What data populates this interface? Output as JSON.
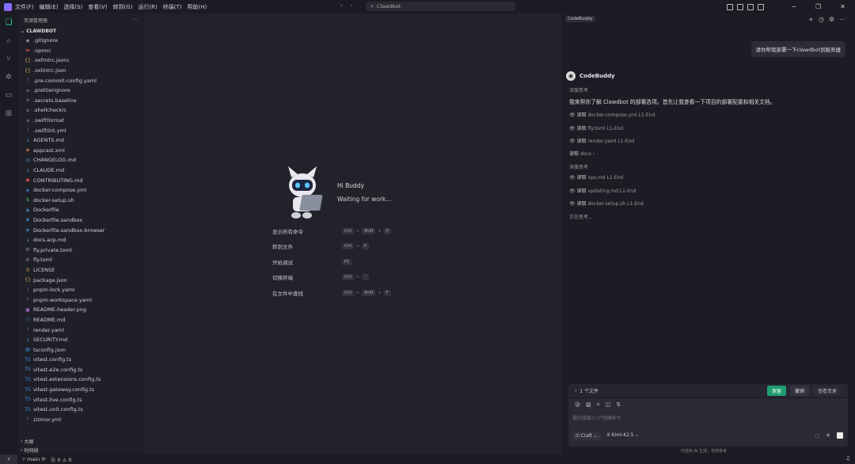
{
  "menu": [
    "文件(F)",
    "编辑(E)",
    "选择(S)",
    "查看(V)",
    "转到(G)",
    "运行(R)",
    "终端(T)",
    "帮助(H)"
  ],
  "search": {
    "text": "Clawdbot"
  },
  "sidebar": {
    "title": "资源管理器",
    "more": "···",
    "project": "CLAWDBOT",
    "files": [
      {
        "name": ".gitignore",
        "icon": "◆",
        "color": "#8a8a95"
      },
      {
        "name": ".npmrc",
        "icon": "▬",
        "color": "#c2413b"
      },
      {
        "name": ".oxfmtrc.jsonc",
        "icon": "{}",
        "color": "#d5b445"
      },
      {
        "name": ".oxlintrc.json",
        "icon": "{}",
        "color": "#d5b445"
      },
      {
        "name": ".pre-commit-config.yaml",
        "icon": "!",
        "color": "#a96fd6"
      },
      {
        "name": ".prettierignore",
        "icon": "≡",
        "color": "#8a8a95"
      },
      {
        "name": ".secrets.baseline",
        "icon": "≡",
        "color": "#8a8a95"
      },
      {
        "name": ".shellcheckrc",
        "icon": "≡",
        "color": "#8a8a95"
      },
      {
        "name": ".swiftformat",
        "icon": "≡",
        "color": "#8a8a95"
      },
      {
        "name": ".swiftlint.yml",
        "icon": "!",
        "color": "#a96fd6"
      },
      {
        "name": "AGENTS.md",
        "icon": "↓",
        "color": "#4aa3df"
      },
      {
        "name": "appcast.xml",
        "icon": "◈",
        "color": "#e07b39"
      },
      {
        "name": "CHANGELOG.md",
        "icon": "◷",
        "color": "#4aa3df"
      },
      {
        "name": "CLAUDE.md",
        "icon": "↓",
        "color": "#4aa3df"
      },
      {
        "name": "CONTRIBUTING.md",
        "icon": "◆",
        "color": "#e05050"
      },
      {
        "name": "docker-compose.yml",
        "icon": "◈",
        "color": "#3b8ee0"
      },
      {
        "name": "docker-setup.sh",
        "icon": "$",
        "color": "#58c05a"
      },
      {
        "name": "Dockerfile",
        "icon": "◈",
        "color": "#3b8ee0"
      },
      {
        "name": "Dockerfile.sandbox",
        "icon": "◈",
        "color": "#3b8ee0"
      },
      {
        "name": "Dockerfile.sandbox-browser",
        "icon": "◈",
        "color": "#3b8ee0"
      },
      {
        "name": "docs.acp.md",
        "icon": "↓",
        "color": "#4aa3df"
      },
      {
        "name": "fly.private.toml",
        "icon": "⚙",
        "color": "#8a8a95"
      },
      {
        "name": "fly.toml",
        "icon": "⚙",
        "color": "#8a8a95"
      },
      {
        "name": "LICENSE",
        "icon": "◎",
        "color": "#d5b445"
      },
      {
        "name": "package.json",
        "icon": "{}",
        "color": "#d5b445"
      },
      {
        "name": "pnpm-lock.yaml",
        "icon": "!",
        "color": "#a96fd6"
      },
      {
        "name": "pnpm-workspace.yaml",
        "icon": "!",
        "color": "#a96fd6"
      },
      {
        "name": "README-header.png",
        "icon": "▣",
        "color": "#a96fd6"
      },
      {
        "name": "README.md",
        "icon": "ⓘ",
        "color": "#4aa3df"
      },
      {
        "name": "render.yaml",
        "icon": "!",
        "color": "#a96fd6"
      },
      {
        "name": "SECURITY.md",
        "icon": "↓",
        "color": "#4aa3df"
      },
      {
        "name": "tsconfig.json",
        "icon": "▤",
        "color": "#3b8ee0"
      },
      {
        "name": "vitest.config.ts",
        "icon": "TS",
        "color": "#3b8ee0"
      },
      {
        "name": "vitest.e2e.config.ts",
        "icon": "TS",
        "color": "#3b8ee0"
      },
      {
        "name": "vitest.extensions.config.ts",
        "icon": "TS",
        "color": "#3b8ee0"
      },
      {
        "name": "vitest.gateway.config.ts",
        "icon": "TS",
        "color": "#3b8ee0"
      },
      {
        "name": "vitest.live.config.ts",
        "icon": "TS",
        "color": "#3b8ee0"
      },
      {
        "name": "vitest.unit.config.ts",
        "icon": "TS",
        "color": "#3b8ee0"
      },
      {
        "name": "zizmor.yml",
        "icon": "!",
        "color": "#a96fd6"
      }
    ],
    "outline": "大纲",
    "timeline": "时间线"
  },
  "editor": {
    "greeting": "Hi Buddy",
    "status": "Waiting for work...",
    "shortcuts": [
      {
        "label": "显示所有命令",
        "keys": [
          "Ctrl",
          "Shift",
          "P"
        ]
      },
      {
        "label": "转到文件",
        "keys": [
          "Ctrl",
          "P"
        ]
      },
      {
        "label": "开始调试",
        "keys": [
          "F5"
        ]
      },
      {
        "label": "切换终端",
        "keys": [
          "Ctrl",
          "`"
        ]
      },
      {
        "label": "在文件中查找",
        "keys": [
          "Ctrl",
          "Shift",
          "F"
        ]
      }
    ]
  },
  "panel": {
    "tag": "CodeBuddy",
    "user_message": "请你帮我部署一下clawdbot到服务器",
    "assistant_name": "CodeBuddy",
    "deep_think_1": "深度思考",
    "intro": "我来帮你了解 Clawdbot 的部署选项。首先让我查看一下项目的部署配置和相关文档。",
    "reads_1": [
      {
        "verb": "读取",
        "file": "docker-compose.yml L1-End"
      },
      {
        "verb": "读取",
        "file": "fly.toml L1-End"
      },
      {
        "verb": "读取",
        "file": "render.yaml L1-End"
      }
    ],
    "read_docs": {
      "verb": "读取",
      "file": "docs"
    },
    "deep_think_2": "深度思考",
    "reads_2": [
      {
        "verb": "读取",
        "file": "vps.md L1-End"
      },
      {
        "verb": "读取",
        "file": "updating.md L1-End"
      },
      {
        "verb": "读取",
        "file": "docker-setup.sh L1-End"
      }
    ],
    "thinking": "正在思考...",
    "changes": {
      "count": "1 个文件",
      "keep": "保留",
      "undo": "撤销",
      "view": "查看变更"
    },
    "input": {
      "placeholder": "提问或输入\"/\"快捷命令",
      "mode": "Craft",
      "model": "Kimi-K2.5"
    },
    "footnote": "内容由 AI 生成，仅供参考"
  },
  "statusbar": {
    "branch": "main",
    "problems": "⓪ 0 ⚠ 0"
  }
}
